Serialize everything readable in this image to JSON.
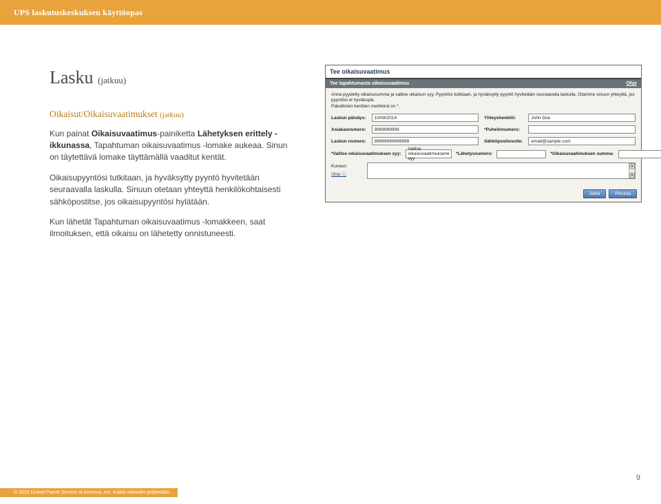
{
  "header": {
    "title": "UPS laskutuskeskuksen käyttöopas"
  },
  "left": {
    "h1": "Lasku",
    "h1_cont": "(jatkuu)",
    "h2": "Oikaisut/Oikaisuvaatimukset",
    "h2_cont": "(jatkuu)",
    "p1_a": "Kun painat ",
    "p1_strong1": "Oikaisuvaatimus",
    "p1_b": "-painiketta ",
    "p1_strong2": "Lähetyksen erittely -ikkunassa",
    "p1_c": ", Tapahtuman oikaisuvaatimus -lomake aukeaa. Sinun on täytettävä lomake täyttämällä vaaditut kentät.",
    "p2": "Oikaisupyyntösi tutkitaan, ja hyväksytty pyyntö hyvitetään seuraavalla laskulla. Sinuun otetaan yhteyttä henkilökohtaisesti sähköpostitse, jos oikaisupyyntösi hylätään.",
    "p3": "Kun lähetät Tapahtuman oikaisuvaatimus -lomakkeen, saat ilmoituksen, että oikaisu on lähetetty onnistuneesti."
  },
  "ss": {
    "title": "Tee oikaisuvaatimus",
    "bar_label": "Tee tapahtumasta oikaisuvaatimus",
    "bar_help": "Ohje",
    "intro": "Anna pyydetty oikaisusumma ja valitse oikaisun syy. Pyyntösi tutkitaan, ja hyväksytty pyyntö hyvitetään seuraavalla laskulla. Otamme sinuun yhteyttä, jos pyyntösi ei hyväksytä.",
    "req_note": "Pakollisten kenttien merkkinä on *.",
    "rows": {
      "laskun_paivays_lbl": "Laskun päiväys:",
      "laskun_paivays_val": "10/08/2014",
      "yhteyshenkilo_lbl": "Yhteyshenkilö:",
      "yhteyshenkilo_val": "John Doe",
      "asiakasnumero_lbl": "Asiakasnumero:",
      "asiakasnumero_val": "9999999999",
      "puhelin_lbl": "*Puhelinnumero:",
      "puhelin_val": "",
      "laskunumero_lbl": "Laskun numero:",
      "laskunumero_val": "99999999999999",
      "email_lbl": "Sähköpostiosoite:",
      "email_val": "email@sample.com",
      "syy_lbl": "*Valitse oikaisuvaatimuksen syy:",
      "syy_val": "Valitse oikaisuvaatimuksen syy",
      "lahetys_lbl": "*Lähetysnumero:",
      "summa_lbl": "*Oikaisuvaatimuksen summa:"
    },
    "kuvaus_lbl": "Kuvaus:",
    "ohje_link": "Ohje",
    "btn_submit": "Jatka",
    "btn_cancel": "Peruuta"
  },
  "page_number": "9",
  "footer": "© 2015 United Parcel Service of America, Inc. Kaikki oikeudet pidätetään."
}
